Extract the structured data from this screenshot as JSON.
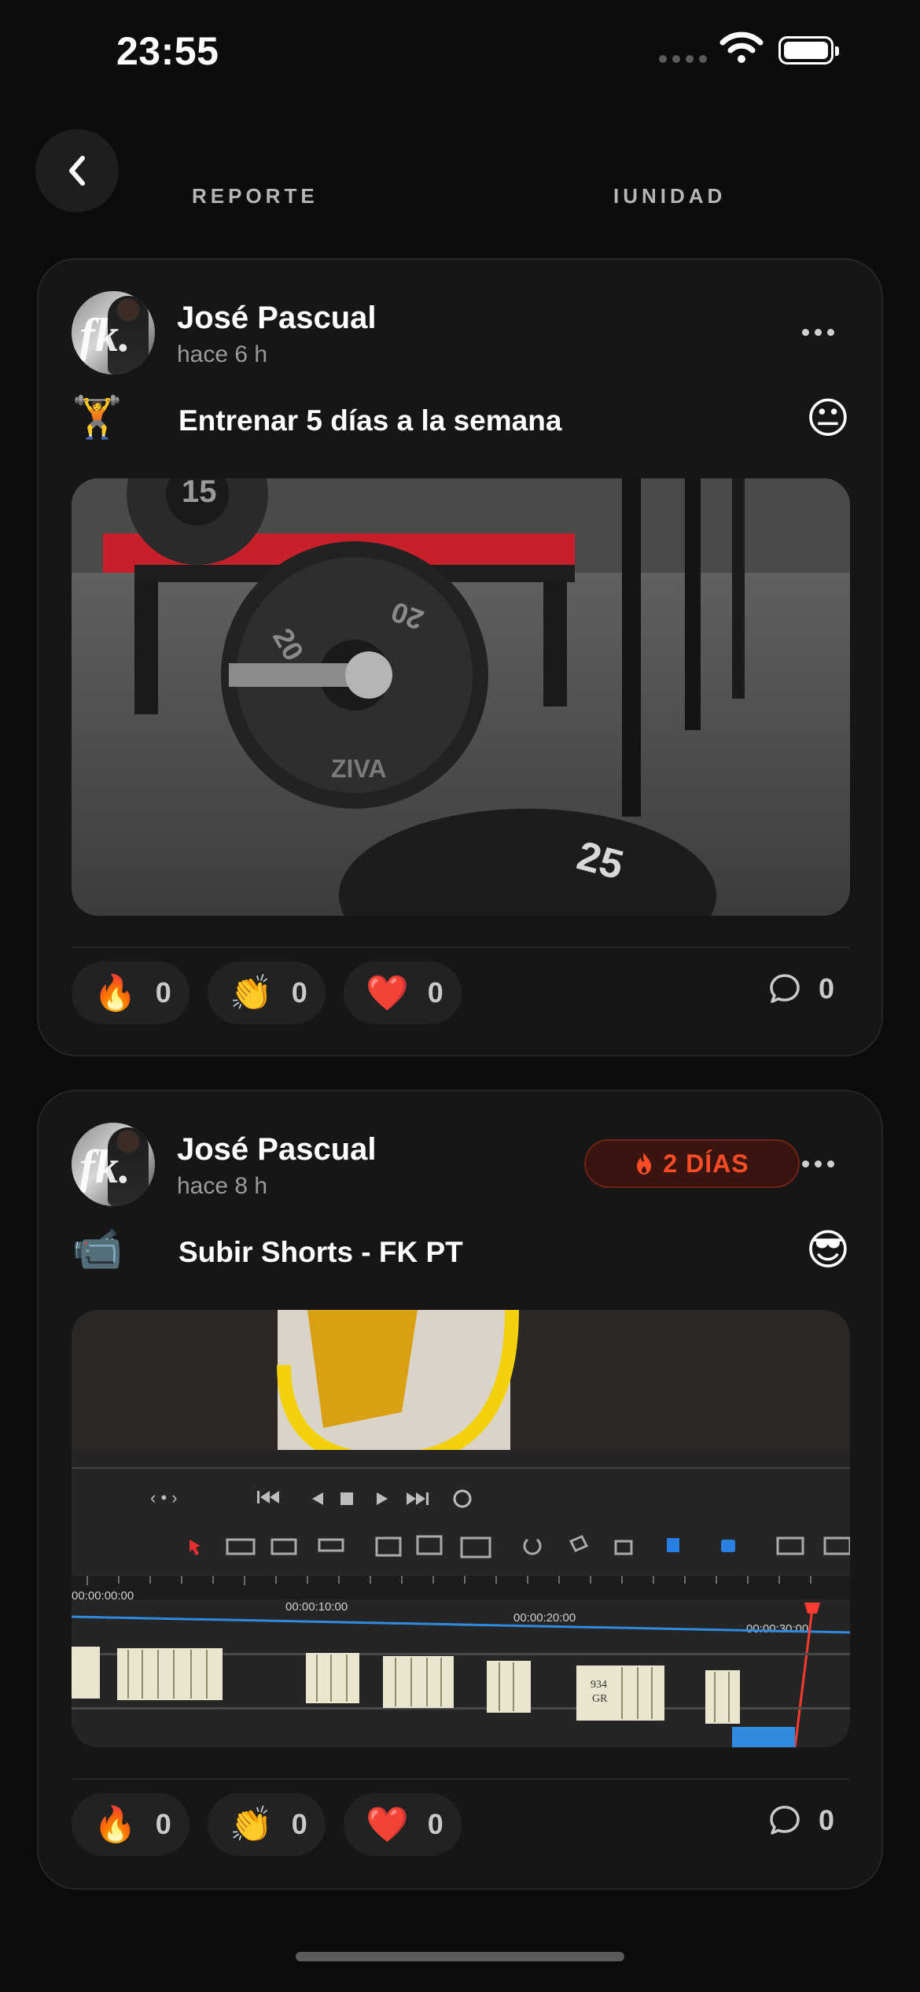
{
  "status_bar": {
    "time": "23:55"
  },
  "tabs": {
    "left": "REPORTE",
    "right": "IUNIDAD"
  },
  "posts": [
    {
      "user": "José Pascual",
      "time_ago": "hace 6 h",
      "goal_icon": "🏋️",
      "goal": "Entrenar 5 días a la semana",
      "mood": "😐",
      "reactions": [
        {
          "emoji": "🔥",
          "count": "0"
        },
        {
          "emoji": "👏",
          "count": "0"
        },
        {
          "emoji": "❤️",
          "count": "0"
        }
      ],
      "comments": "0",
      "media_labels": {
        "plate_top": "15",
        "plate_center_a": "20",
        "plate_center_b": "20",
        "plate_brand": "ZIVA",
        "plate_bottom": "25"
      }
    },
    {
      "user": "José Pascual",
      "time_ago": "hace 8 h",
      "streak": "2 DÍAS",
      "goal_icon": "📹",
      "goal": "Subir Shorts - FK PT",
      "mood": "😎",
      "reactions": [
        {
          "emoji": "🔥",
          "count": "0"
        },
        {
          "emoji": "👏",
          "count": "0"
        },
        {
          "emoji": "❤️",
          "count": "0"
        }
      ],
      "comments": "0",
      "media_labels": {
        "tc0": "00:00:00:00",
        "tc1": "00:00:10:00",
        "tc2": "00:00:20:00",
        "tc3": "00:00:30:00",
        "clip_label_a": "934",
        "clip_label_b": "GR"
      }
    }
  ],
  "colors": {
    "background": "#0c0c0c",
    "card": "#161616",
    "streak_accent": "#ff4b26"
  }
}
